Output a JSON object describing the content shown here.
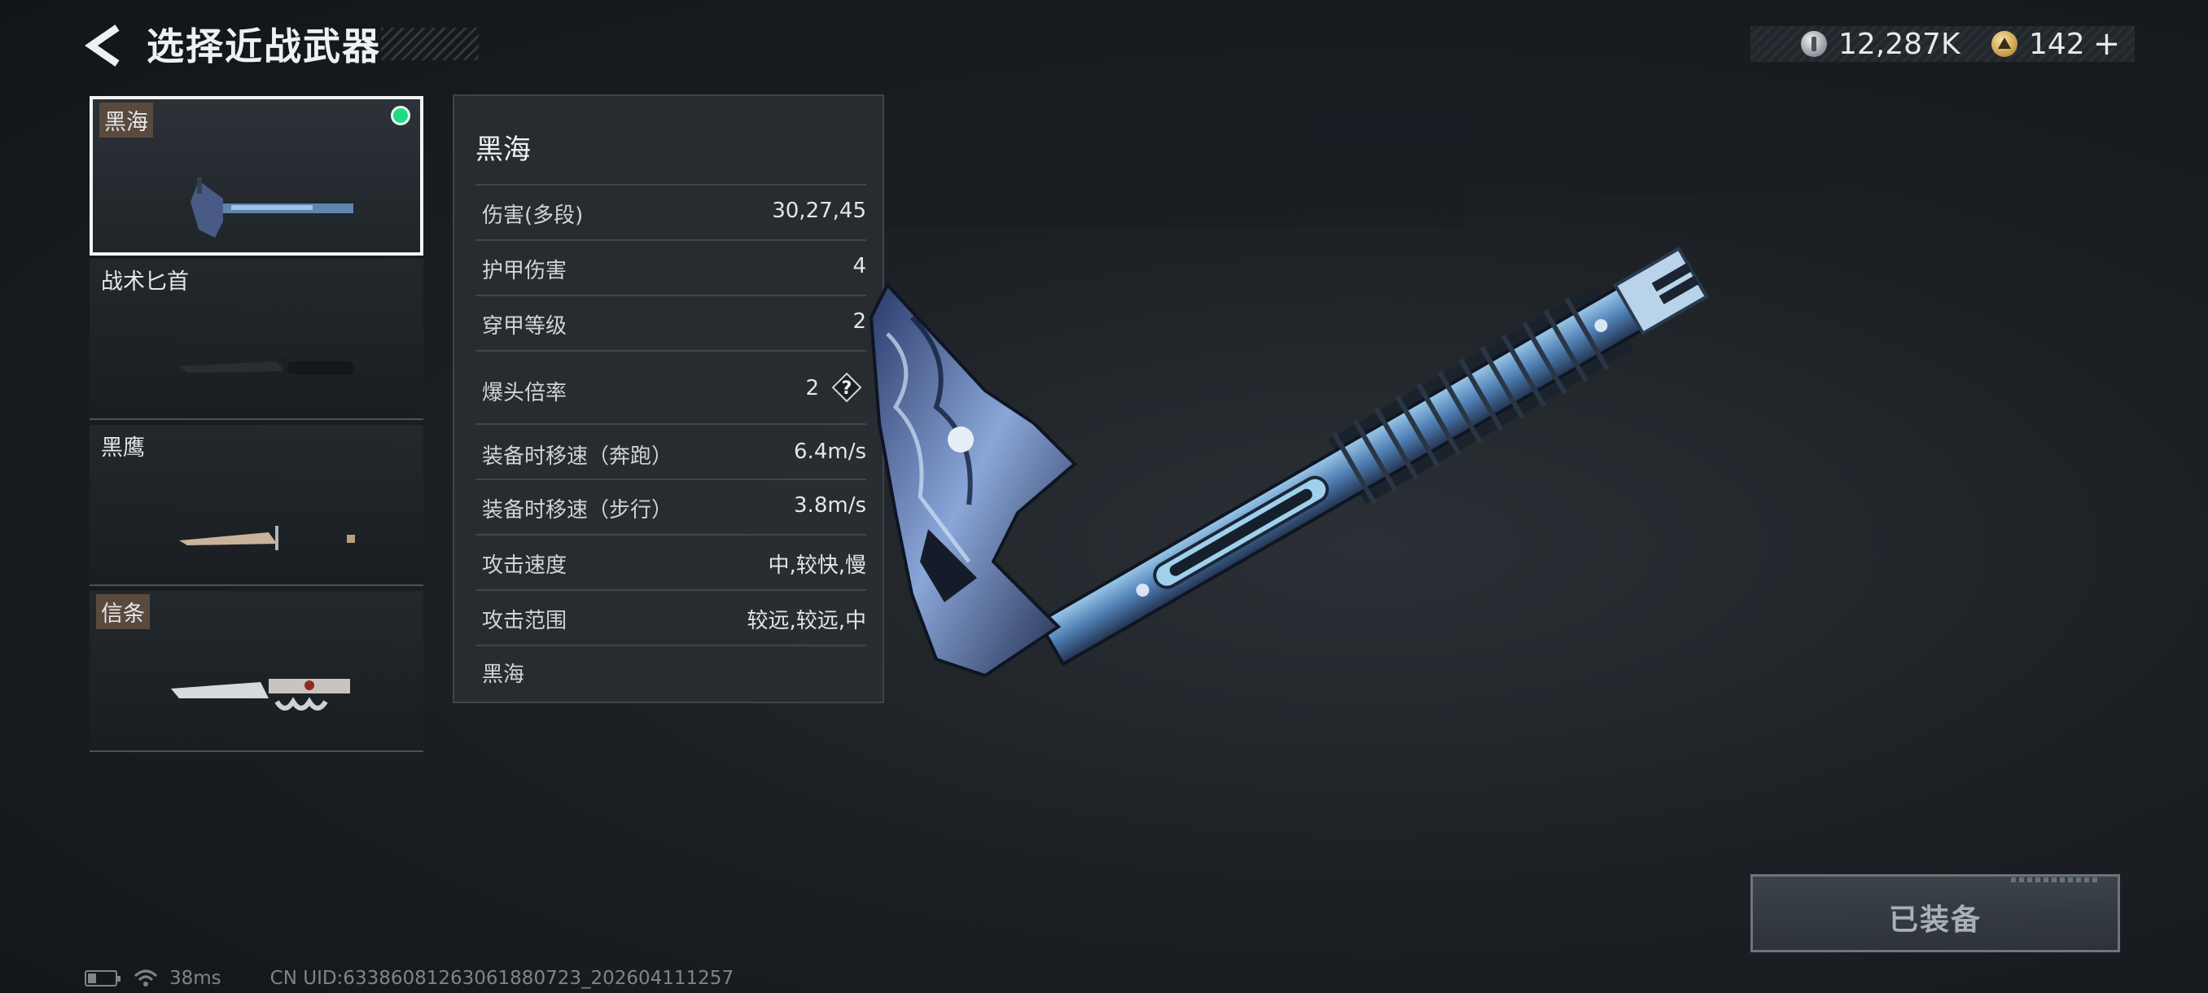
{
  "header": {
    "title": "选择近战武器",
    "back_icon": "back-arrow-icon"
  },
  "currency": {
    "silver": {
      "icon": "silver-coin-icon",
      "amount": "12,287K"
    },
    "gold": {
      "icon": "gold-coin-icon",
      "amount": "142",
      "add": "+"
    }
  },
  "weapons": [
    {
      "name": "黑海",
      "tagged": true,
      "selected": true,
      "equipped": true
    },
    {
      "name": "战术匕首",
      "tagged": false,
      "selected": false,
      "equipped": false
    },
    {
      "name": "黑鹰",
      "tagged": false,
      "selected": false,
      "equipped": false
    },
    {
      "name": "信条",
      "tagged": true,
      "selected": false,
      "equipped": false
    }
  ],
  "stats": {
    "title": "黑海",
    "rows": [
      {
        "label": "伤害(多段)",
        "value": "30,27,45"
      },
      {
        "label": "护甲伤害",
        "value": "4"
      },
      {
        "label": "穿甲等级",
        "value": "2"
      },
      {
        "label": "爆头倍率",
        "value": "2",
        "help": "?"
      },
      {
        "label": "装备时移速（奔跑）",
        "value": "6.4m/s"
      },
      {
        "label": "装备时移速（步行）",
        "value": "3.8m/s"
      },
      {
        "label": "攻击速度",
        "value": "中,较快,慢"
      },
      {
        "label": "攻击范围",
        "value": "较远,较远,中"
      }
    ],
    "footer": "黑海"
  },
  "equip_button": {
    "label": "已装备"
  },
  "status": {
    "ping": "38ms",
    "uid": "CN UID:6338608126306188072​3_202604111257"
  },
  "colors": {
    "equipped_dot": "#1fdc83",
    "accent_blue": "#5b7fc4"
  }
}
